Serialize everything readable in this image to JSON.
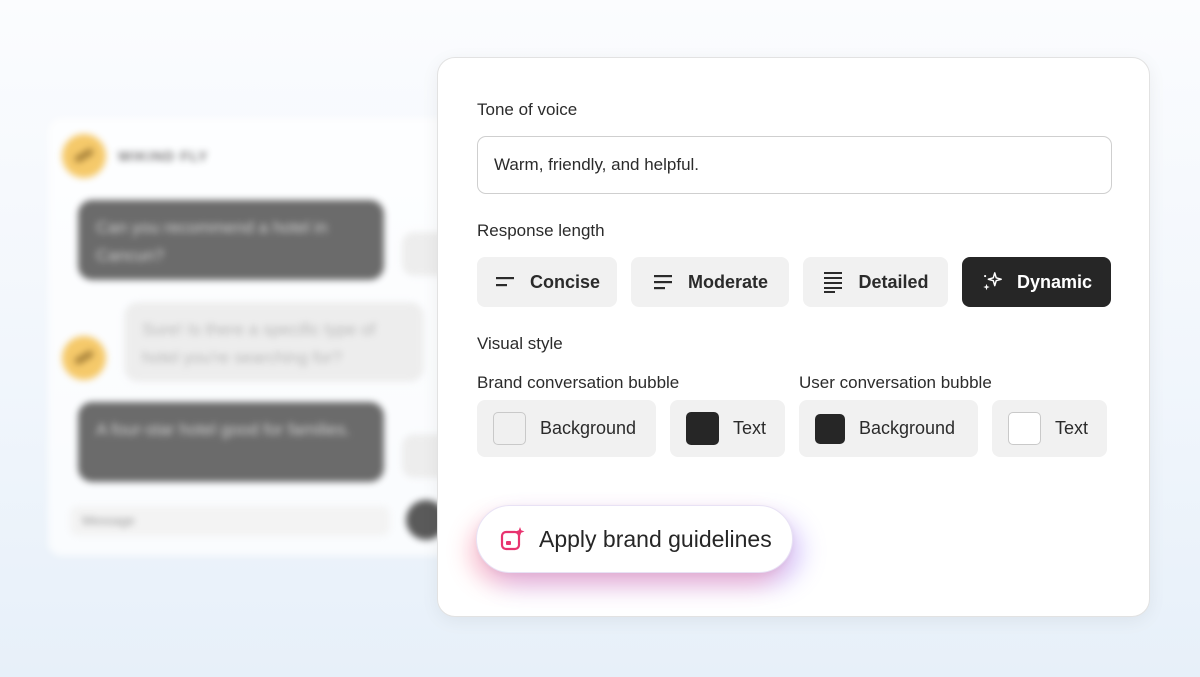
{
  "chat_preview": {
    "brand_name": "WIKIND FLY",
    "messages": [
      "Can you recommend a hotel in Cancun?",
      "Sure! Is there a specific type of hotel you're searching for?",
      "A four-star hotel good for families."
    ],
    "message_placeholder": "Message"
  },
  "panel": {
    "tone": {
      "label": "Tone of voice",
      "value": "Warm, friendly, and helpful."
    },
    "response_length": {
      "label": "Response length",
      "options": [
        {
          "label": "Concise",
          "icon": "align-short-icon",
          "selected": false
        },
        {
          "label": "Moderate",
          "icon": "align-medium-icon",
          "selected": false
        },
        {
          "label": "Detailed",
          "icon": "align-long-icon",
          "selected": false
        },
        {
          "label": "Dynamic",
          "icon": "sparkle-icon",
          "selected": true
        }
      ]
    },
    "visual_style": {
      "label": "Visual style",
      "brand_bubble": {
        "label": "Brand conversation bubble",
        "background": {
          "label": "Background",
          "color": "#f0f0f0"
        },
        "text": {
          "label": "Text",
          "color": "#262626"
        }
      },
      "user_bubble": {
        "label": "User conversation bubble",
        "background": {
          "label": "Background",
          "color": "#262626"
        },
        "text": {
          "label": "Text",
          "color": "#ffffff"
        }
      }
    },
    "apply_button": {
      "label": "Apply brand guidelines",
      "icon": "magic-image-icon"
    }
  },
  "colors": {
    "accent_pink": "#e8336f",
    "accent_purple": "#8c6eff",
    "selected_bg": "#262626"
  }
}
